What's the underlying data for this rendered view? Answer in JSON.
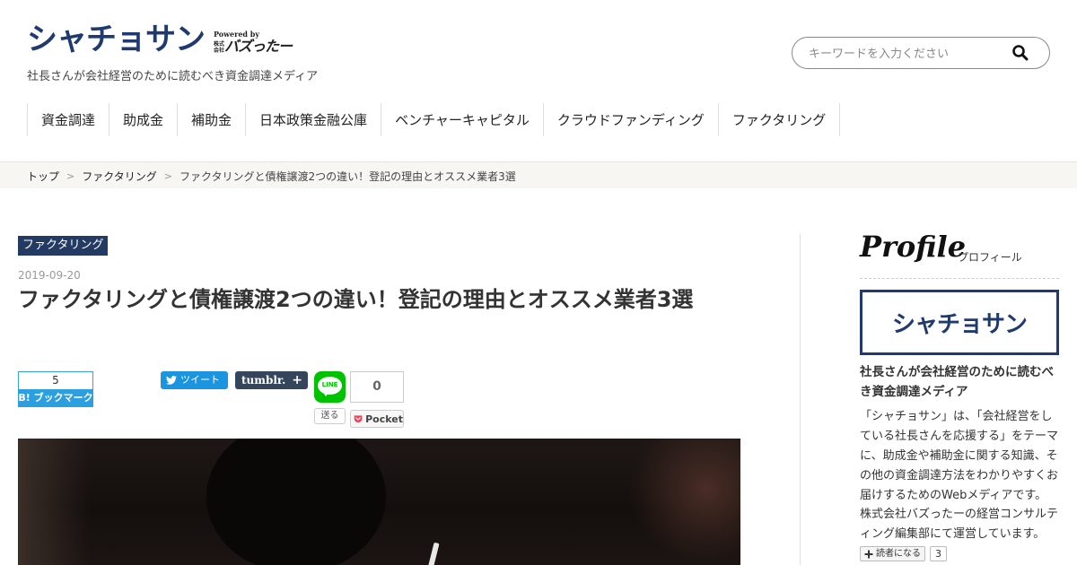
{
  "site": {
    "logo_text": "シャチョサン",
    "powered_by": "Powered by",
    "powered_kaisha": "株式会社",
    "powered_name": "バズったー",
    "tagline": "社長さんが会社経営のために読むべき資金調達メディア"
  },
  "search": {
    "placeholder": "キーワードを入力ください",
    "value": "",
    "icon": "search-icon"
  },
  "nav": {
    "items": [
      {
        "label": "資金調達"
      },
      {
        "label": "助成金"
      },
      {
        "label": "補助金"
      },
      {
        "label": "日本政策金融公庫"
      },
      {
        "label": "ベンチャーキャピタル"
      },
      {
        "label": "クラウドファンディング"
      },
      {
        "label": "ファクタリング"
      }
    ]
  },
  "breadcrumb": {
    "home": "トップ",
    "category": "ファクタリング",
    "current": "ファクタリングと債権譲渡2つの違い！登記の理由とオススメ業者3選",
    "separator": ">"
  },
  "article": {
    "category": "ファクタリング",
    "date": "2019-09-20",
    "title": "ファクタリングと債権譲渡2つの違い！登記の理由とオススメ業者3選"
  },
  "share": {
    "hatena_count": "5",
    "hatena_label": "B! ブックマーク",
    "tweet_label": "ツイート",
    "tumblr_label": "tumblr.",
    "tumblr_plus": "+",
    "line_label": "LINE",
    "line_send": "送る",
    "pocket_count": "0",
    "pocket_label": "Pocket"
  },
  "sidebar": {
    "profile_title": "Profile",
    "profile_sub": "プロフィール",
    "logo_text": "シャチョサン",
    "headline": "社長さんが会社経営のために読むべき資金調達メディア",
    "description": "「シャチョサン」は、「会社経営をしている社長さんを応援する」をテーマに、助成金や補助金に関する知識、その他の資金調達方法をわかりやすくお届けするためのWebメディアです。",
    "description2": "株式会社バズったーの経営コンサルティング編集部にて運営しています。",
    "subscribe_label": "読者になる",
    "subscribe_count": "3"
  },
  "colors": {
    "brand": "#1f3a6e",
    "category_badge": "#233a63",
    "twitter": "#1b95e0",
    "tumblr": "#35465c",
    "line": "#00c300",
    "pocket": "#ef4056",
    "hatena": "#2b9fe0"
  }
}
